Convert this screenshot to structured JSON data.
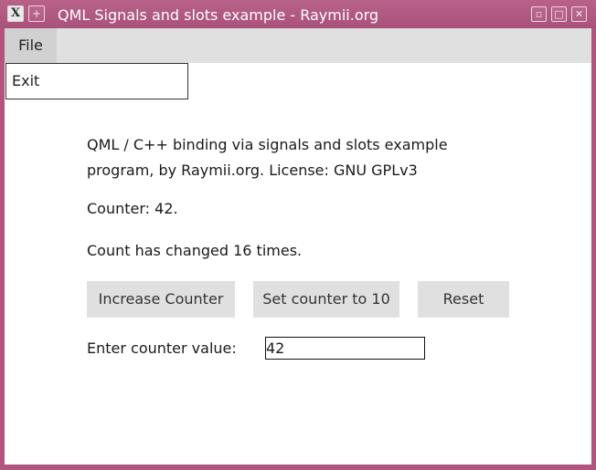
{
  "window": {
    "title": "QML Signals and slots example - Raymii.org",
    "icons": {
      "app": "x-app-icon",
      "pin": "plus-icon",
      "minimize": "minimize-icon",
      "maximize": "maximize-icon",
      "close": "close-icon"
    },
    "colors": {
      "frame": "#b0567e",
      "title_text": "#ffffff"
    }
  },
  "menubar": {
    "file_label": "File",
    "file_menu": {
      "exit_label": "Exit"
    }
  },
  "content": {
    "description": "QML / C++ binding via signals and slots example program, by Raymii.org. License: GNU GPLv3",
    "counter_text": "Counter: 42.",
    "changed_text": "Count has changed 16 times.",
    "buttons": {
      "increase": "Increase Counter",
      "set": "Set counter to 10",
      "reset": "Reset"
    },
    "enter_label": "Enter counter value:",
    "counter_input_value": "42"
  }
}
